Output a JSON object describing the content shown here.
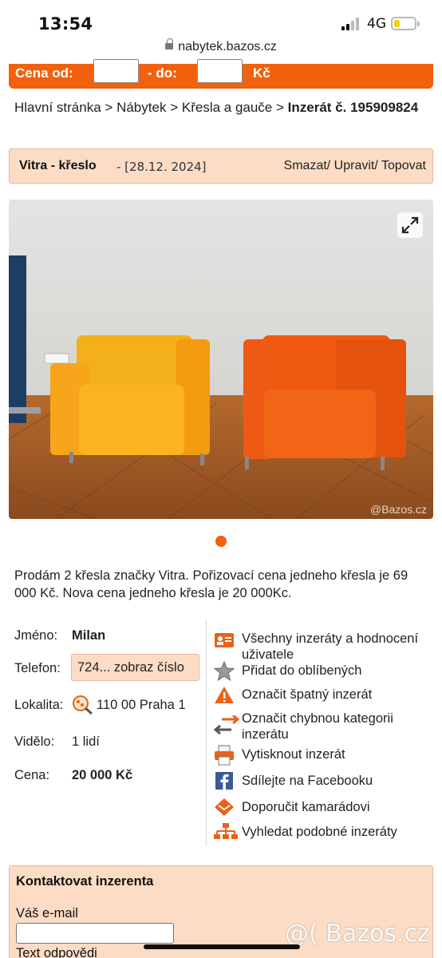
{
  "status": {
    "time": "13:54",
    "network": "4G"
  },
  "browser": {
    "url": "nabytek.bazos.cz"
  },
  "price_filter": {
    "from_label": "Cena od:",
    "to_label": "- do:",
    "currency": "Kč",
    "from_value": "",
    "to_value": ""
  },
  "breadcrumb": {
    "home": "Hlavní stránka",
    "sep": ">",
    "cat1": "Nábytek",
    "cat2": "Křesla a gauče",
    "current": "Inzerát č. 195909824"
  },
  "listing": {
    "title": "Vitra - křeslo",
    "date": "- [28.12. 2024]",
    "actions": "Smazat/ Upravit/ Topovat",
    "photo_watermark": "@Bazos.cz",
    "description": "Prodám 2 křesla značky Vitra. Pořizovací cena jedneho křesla je 69 000 Kč. Nova cena jedneho křesla je 20 000Kc."
  },
  "details": {
    "name_label": "Jméno:",
    "name": "Milan",
    "phone_label": "Telefon:",
    "phone": "724... zobraz číslo",
    "location_label": "Lokalita:",
    "location": "110 00 Praha 1",
    "views_label": "Vidělo:",
    "views": "1 lidí",
    "price_label": "Cena:",
    "price": "20 000 Kč"
  },
  "side_actions": [
    {
      "label": "Všechny inzeráty a hodnocení uživatele",
      "icon": "user-card-icon"
    },
    {
      "label": "Přidat do oblíbených",
      "icon": "star-icon"
    },
    {
      "label": "Označit špatný inzerát",
      "icon": "warning-icon"
    },
    {
      "label": "Označit chybnou kategorii inzerátu",
      "icon": "swap-arrows-icon"
    },
    {
      "label": "Vytisknout inzerát",
      "icon": "printer-icon"
    },
    {
      "label": "Sdílejte na Facebooku",
      "icon": "facebook-icon"
    },
    {
      "label": "Doporučit kamarádovi",
      "icon": "envelope-icon"
    },
    {
      "label": "Vyhledat podobné inzeráty",
      "icon": "sitemap-icon"
    }
  ],
  "contact": {
    "heading": "Kontaktovat inzerenta",
    "email_label": "Váš e-mail",
    "email_value": "",
    "reply_label": "Text odpovědi"
  },
  "screen_watermark": "@( Bazos.cz",
  "colors": {
    "accent": "#f2610d",
    "panel": "#fcdcc5",
    "panel_border": "#e6b79a"
  }
}
